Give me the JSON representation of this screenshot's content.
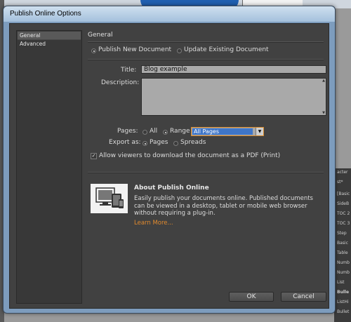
{
  "dialog": {
    "title": "Publish Online Options"
  },
  "nav": {
    "items": [
      {
        "label": "General",
        "selected": true
      },
      {
        "label": "Advanced",
        "selected": false
      }
    ]
  },
  "general": {
    "section_title": "General",
    "mode_options": [
      {
        "label": "Publish New Document",
        "selected": true
      },
      {
        "label": "Update Existing Document",
        "selected": false
      }
    ],
    "title_label": "Title:",
    "title_value": "Blog example",
    "description_label": "Description:",
    "description_value": "",
    "pages_label": "Pages:",
    "pages_options": [
      {
        "label": "All",
        "selected": false
      },
      {
        "label": "Range",
        "selected": true
      }
    ],
    "range_value": "All Pages",
    "export_label": "Export as:",
    "export_options": [
      {
        "label": "Pages",
        "selected": true
      },
      {
        "label": "Spreads",
        "selected": false
      }
    ],
    "allow_download_label": "Allow viewers to download the document as a PDF (Print)",
    "allow_download_checked": true
  },
  "about": {
    "title": "About Publish Online",
    "body": "Easily publish your documents online. Published documents can be viewed in a desktop, tablet or mobile web browser without requiring a plug-in.",
    "learn_more": "Learn More..."
  },
  "buttons": {
    "ok": "OK",
    "cancel": "Cancel"
  },
  "background_panel": {
    "rows": [
      "acter",
      "st*",
      "[Basic",
      "SideB",
      "TOC 2",
      "TOC 3",
      "Step",
      "Basic",
      "Table",
      "Numb",
      "Numb",
      "List",
      "Bulle",
      "ListHi",
      "Bullet"
    ]
  },
  "colors": {
    "dialog_bg": "#414141",
    "accent_link": "#e08a2e",
    "selection": "#3f76c9"
  }
}
